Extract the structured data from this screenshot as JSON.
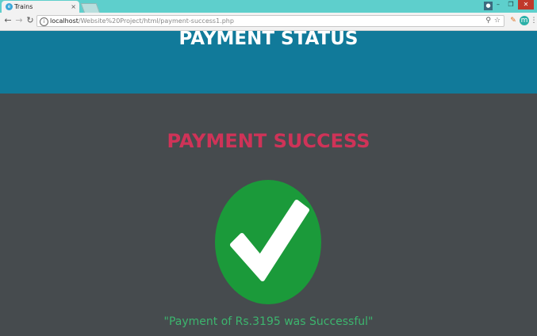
{
  "browser": {
    "tab_title": "Trains",
    "tab_favicon": "e",
    "url_host": "localhost",
    "url_path": "/Website%20Project/html/payment-success1.php",
    "icons": {
      "back": "back-arrow-icon",
      "forward": "forward-arrow-icon",
      "reload": "reload-icon",
      "info": "info-icon",
      "search": "search-icon",
      "bookmark": "star-icon"
    }
  },
  "header": {
    "title": "PAYMENT STATUS",
    "background": "#117a9a"
  },
  "main": {
    "heading": "PAYMENT SUCCESS",
    "heading_color": "#cf3358",
    "status_icon": "checkmark-icon",
    "status_icon_color": "#1b9a3a",
    "message": "\"Payment of Rs.3195 was Successful\"",
    "message_color": "#3cb56e"
  }
}
